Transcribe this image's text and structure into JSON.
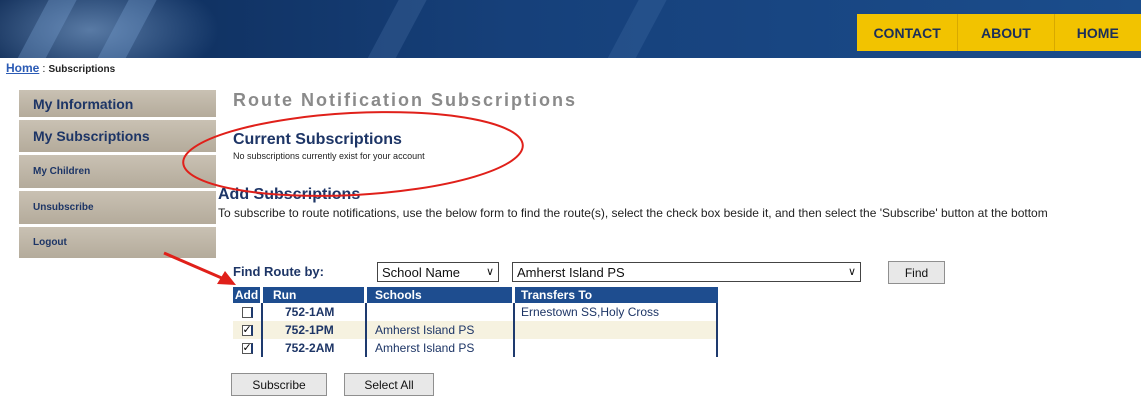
{
  "nav": [
    "CONTACT",
    "ABOUT",
    "HOME"
  ],
  "breadcrumb": {
    "home": "Home",
    "sep": " : ",
    "current": "Subscriptions"
  },
  "sidebar": {
    "items": [
      {
        "label": "My Information"
      },
      {
        "label": "My Subscriptions"
      },
      {
        "label": "My Children"
      },
      {
        "label": "Unsubscribe"
      },
      {
        "label": "Logout"
      }
    ]
  },
  "page_title": "Route Notification Subscriptions",
  "current": {
    "title": "Current Subscriptions",
    "note": "No subscriptions currently exist for your account"
  },
  "add": {
    "title": "Add Subscriptions",
    "description": "To subscribe to route notifications, use the below form to find the route(s), select the check box beside it, and then select the 'Subscribe' button at the bottom"
  },
  "find": {
    "label": "Find Route by:",
    "by_selected": "School Name",
    "school_selected": "Amherst Island PS",
    "button": "Find"
  },
  "table": {
    "headers": {
      "add": "Add",
      "run": "Run",
      "schools": "Schools",
      "transfers": "Transfers To"
    },
    "rows": [
      {
        "checked": false,
        "run": "752-1AM",
        "schools": "",
        "transfers": "Ernestown SS,Holy Cross"
      },
      {
        "checked": true,
        "run": "752-1PM",
        "schools": "Amherst Island PS",
        "transfers": ""
      },
      {
        "checked": true,
        "run": "752-2AM",
        "schools": "Amherst Island PS",
        "transfers": ""
      }
    ]
  },
  "buttons": {
    "subscribe": "Subscribe",
    "select_all": "Select All"
  },
  "colors": {
    "annotation": "#e0201a",
    "nav_bg": "#f2c300",
    "header_bg": "#16407a",
    "table_header": "#1e4d8f"
  }
}
